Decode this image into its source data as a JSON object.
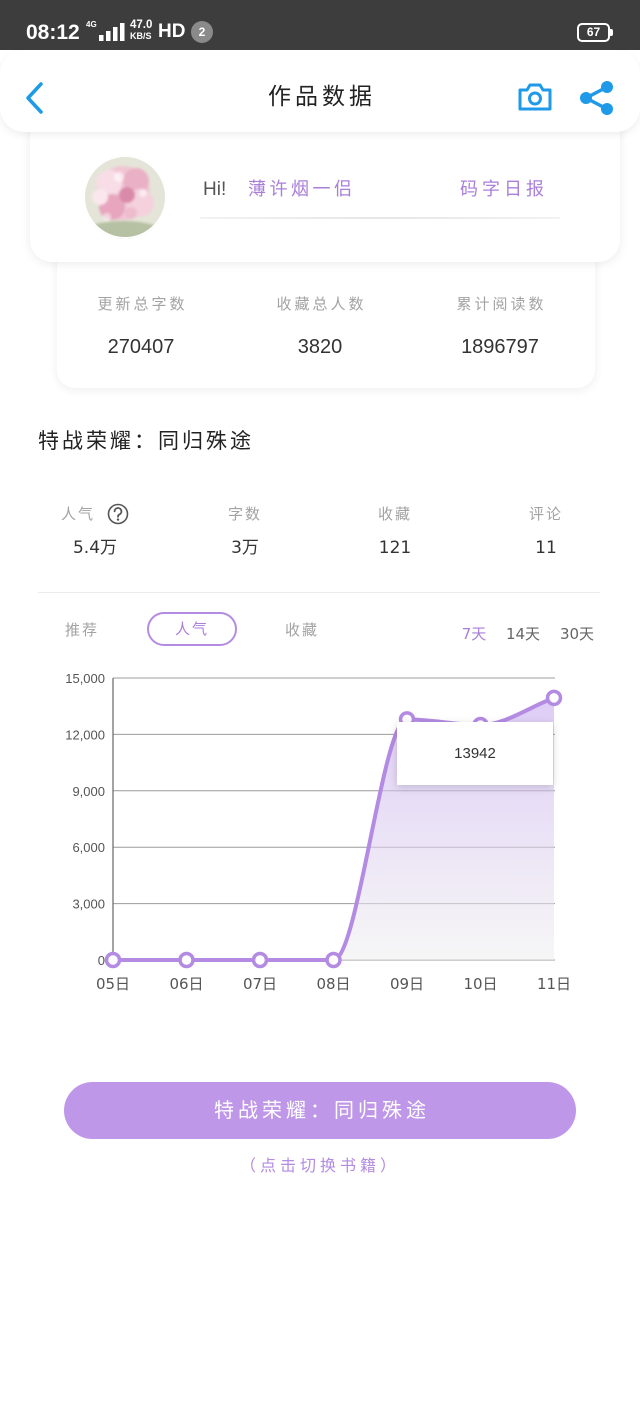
{
  "status_bar": {
    "time": "08:12",
    "network": "4G",
    "speed_value": "47.0",
    "speed_unit": "KB/S",
    "hd": "HD",
    "notification_count": "2",
    "battery": "67",
    "icons": {
      "signal": "signal-icon",
      "battery": "battery-icon"
    }
  },
  "header": {
    "title": "作品数据",
    "icons": {
      "back": "chevron-left-icon",
      "camera": "camera-icon",
      "share": "share-icon"
    }
  },
  "profile": {
    "greeting": "Hi!",
    "username": "薄许烟一侣",
    "daily_report_link": "码字日报",
    "avatar_icon": "avatar-image"
  },
  "summary": [
    {
      "label": "更新总字数",
      "value": "270407"
    },
    {
      "label": "收藏总人数",
      "value": "3820"
    },
    {
      "label": "累计阅读数",
      "value": "1896797"
    }
  ],
  "book": {
    "title": "特战荣耀：同归殊途"
  },
  "metrics": [
    {
      "label": "人气",
      "value": "5.4万",
      "icon": "help-circle-icon"
    },
    {
      "label": "字数",
      "value": "3万"
    },
    {
      "label": "收藏",
      "value": "121"
    },
    {
      "label": "评论",
      "value": "11"
    }
  ],
  "tabs": [
    {
      "label": "推荐",
      "selected": false
    },
    {
      "label": "人气",
      "selected": true
    },
    {
      "label": "收藏",
      "selected": false
    }
  ],
  "ranges": [
    {
      "label": "7天",
      "selected": true
    },
    {
      "label": "14天",
      "selected": false
    },
    {
      "label": "30天",
      "selected": false
    }
  ],
  "chart_data": {
    "type": "line",
    "categories": [
      "05日",
      "06日",
      "07日",
      "08日",
      "09日",
      "10日",
      "11日"
    ],
    "series": [
      {
        "values": [
          0,
          0,
          0,
          0,
          12800,
          12500,
          13942
        ]
      }
    ],
    "y_ticks": [
      0,
      3000,
      6000,
      9000,
      12000,
      15000
    ],
    "ylim": [
      0,
      15000
    ],
    "grid": true,
    "smooth": true,
    "tooltip": {
      "point_index": 6,
      "value": "13942"
    }
  },
  "switch_book": {
    "button_label": "特战荣耀：同归殊途",
    "hint": "（点击切换书籍）"
  },
  "colors": {
    "accent_blue": "#1f9ae8",
    "accent_purple": "#b48be3",
    "text_purple": "#a97fda",
    "button_purple": "#bf97e8",
    "status_bar": "#3d3d3d"
  }
}
